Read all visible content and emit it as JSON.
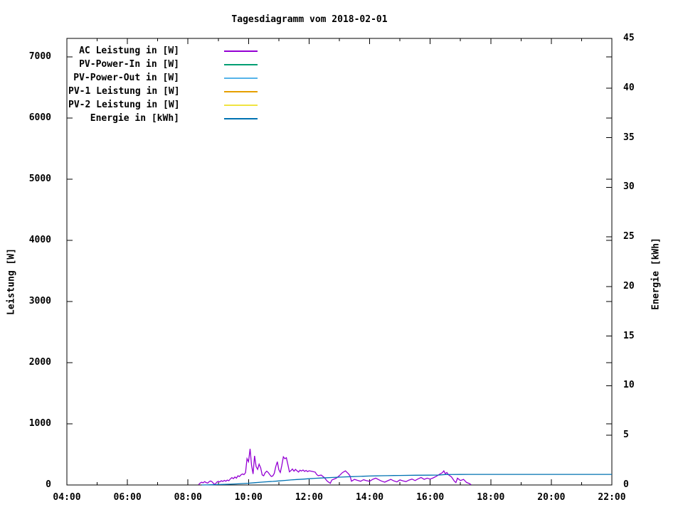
{
  "chart_data": {
    "type": "line",
    "title": "Tagesdiagramm vom 2018-02-01",
    "grid": false,
    "legend_position": "top-left-inside",
    "background_color": "#ffffff",
    "axis_color": "#000000",
    "x_axis": {
      "unit": "time",
      "min_hour": 4,
      "max_hour": 22,
      "major_hours": [
        4,
        6,
        8,
        10,
        12,
        14,
        16,
        18,
        20,
        22
      ],
      "major_labels": [
        "04:00",
        "06:00",
        "08:00",
        "10:00",
        "12:00",
        "14:00",
        "16:00",
        "18:00",
        "20:00",
        "22:00"
      ],
      "minor_hours": [
        5,
        7,
        9,
        11,
        13,
        15,
        17,
        19,
        21
      ]
    },
    "y_left": {
      "label": "Leistung [W]",
      "min": 0,
      "max": 7300,
      "ticks": [
        0,
        1000,
        2000,
        3000,
        4000,
        5000,
        6000,
        7000
      ]
    },
    "y_right": {
      "label": "Energie [kWh]",
      "min": 0,
      "max": 45,
      "ticks": [
        0,
        5,
        10,
        15,
        20,
        25,
        30,
        35,
        40,
        45
      ]
    },
    "series": [
      {
        "name": "AC Leistung in [W]",
        "color": "#9400d3",
        "yaxis": "left",
        "points": [
          [
            8.35,
            5
          ],
          [
            8.4,
            30
          ],
          [
            8.45,
            45
          ],
          [
            8.5,
            35
          ],
          [
            8.55,
            55
          ],
          [
            8.6,
            40
          ],
          [
            8.65,
            30
          ],
          [
            8.7,
            55
          ],
          [
            8.75,
            65
          ],
          [
            8.8,
            50
          ],
          [
            8.85,
            20
          ],
          [
            8.9,
            12
          ],
          [
            8.95,
            45
          ],
          [
            9.0,
            60
          ],
          [
            9.05,
            50
          ],
          [
            9.1,
            70
          ],
          [
            9.15,
            58
          ],
          [
            9.2,
            75
          ],
          [
            9.25,
            62
          ],
          [
            9.3,
            80
          ],
          [
            9.35,
            70
          ],
          [
            9.4,
            100
          ],
          [
            9.45,
            120
          ],
          [
            9.5,
            105
          ],
          [
            9.55,
            130
          ],
          [
            9.6,
            112
          ],
          [
            9.65,
            150
          ],
          [
            9.7,
            138
          ],
          [
            9.75,
            165
          ],
          [
            9.8,
            180
          ],
          [
            9.85,
            168
          ],
          [
            9.9,
            200
          ],
          [
            9.95,
            430
          ],
          [
            10.0,
            380
          ],
          [
            10.05,
            590
          ],
          [
            10.1,
            320
          ],
          [
            10.15,
            180
          ],
          [
            10.2,
            475
          ],
          [
            10.25,
            300
          ],
          [
            10.3,
            255
          ],
          [
            10.35,
            340
          ],
          [
            10.4,
            280
          ],
          [
            10.45,
            165
          ],
          [
            10.5,
            150
          ],
          [
            10.55,
            200
          ],
          [
            10.6,
            225
          ],
          [
            10.65,
            205
          ],
          [
            10.7,
            170
          ],
          [
            10.75,
            140
          ],
          [
            10.8,
            148
          ],
          [
            10.85,
            190
          ],
          [
            10.9,
            300
          ],
          [
            10.95,
            380
          ],
          [
            11.0,
            250
          ],
          [
            11.05,
            205
          ],
          [
            11.1,
            320
          ],
          [
            11.15,
            460
          ],
          [
            11.2,
            430
          ],
          [
            11.25,
            445
          ],
          [
            11.3,
            330
          ],
          [
            11.35,
            215
          ],
          [
            11.4,
            235
          ],
          [
            11.45,
            262
          ],
          [
            11.5,
            225
          ],
          [
            11.55,
            255
          ],
          [
            11.6,
            232
          ],
          [
            11.65,
            212
          ],
          [
            11.7,
            242
          ],
          [
            11.75,
            228
          ],
          [
            11.8,
            245
          ],
          [
            11.85,
            222
          ],
          [
            11.9,
            238
          ],
          [
            11.95,
            218
          ],
          [
            12.0,
            232
          ],
          [
            12.1,
            222
          ],
          [
            12.2,
            210
          ],
          [
            12.25,
            172
          ],
          [
            12.3,
            152
          ],
          [
            12.4,
            162
          ],
          [
            12.5,
            122
          ],
          [
            12.6,
            62
          ],
          [
            12.7,
            28
          ],
          [
            12.75,
            80
          ],
          [
            12.8,
            92
          ],
          [
            12.9,
            112
          ],
          [
            13.0,
            152
          ],
          [
            13.1,
            202
          ],
          [
            13.2,
            230
          ],
          [
            13.3,
            182
          ],
          [
            13.35,
            150
          ],
          [
            13.4,
            62
          ],
          [
            13.5,
            92
          ],
          [
            13.6,
            75
          ],
          [
            13.7,
            60
          ],
          [
            13.8,
            86
          ],
          [
            13.9,
            70
          ],
          [
            14.0,
            60
          ],
          [
            14.1,
            92
          ],
          [
            14.2,
            112
          ],
          [
            14.3,
            86
          ],
          [
            14.4,
            62
          ],
          [
            14.5,
            46
          ],
          [
            14.6,
            70
          ],
          [
            14.7,
            92
          ],
          [
            14.8,
            66
          ],
          [
            14.9,
            50
          ],
          [
            15.0,
            82
          ],
          [
            15.1,
            66
          ],
          [
            15.2,
            55
          ],
          [
            15.3,
            80
          ],
          [
            15.4,
            96
          ],
          [
            15.5,
            72
          ],
          [
            15.6,
            100
          ],
          [
            15.7,
            122
          ],
          [
            15.8,
            92
          ],
          [
            15.9,
            112
          ],
          [
            16.0,
            96
          ],
          [
            16.1,
            116
          ],
          [
            16.2,
            142
          ],
          [
            16.3,
            172
          ],
          [
            16.4,
            200
          ],
          [
            16.45,
            230
          ],
          [
            16.5,
            185
          ],
          [
            16.55,
            205
          ],
          [
            16.6,
            168
          ],
          [
            16.7,
            132
          ],
          [
            16.8,
            62
          ],
          [
            16.85,
            40
          ],
          [
            16.9,
            110
          ],
          [
            17.0,
            72
          ],
          [
            17.1,
            92
          ],
          [
            17.2,
            42
          ],
          [
            17.3,
            22
          ],
          [
            17.35,
            2
          ]
        ]
      },
      {
        "name": "PV-Power-In in [W]",
        "color": "#009e73",
        "yaxis": "left",
        "points": []
      },
      {
        "name": "PV-Power-Out in [W]",
        "color": "#56b4e9",
        "yaxis": "left",
        "points": []
      },
      {
        "name": "PV-1 Leistung in [W]",
        "color": "#e69f00",
        "yaxis": "left",
        "points": []
      },
      {
        "name": "PV-2 Leistung in [W]",
        "color": "#f0e442",
        "yaxis": "left",
        "points": []
      },
      {
        "name": "Energie in [kWh]",
        "color": "#0072b2",
        "yaxis": "right",
        "points": [
          [
            8.45,
            0
          ],
          [
            8.6,
            0.01
          ],
          [
            8.8,
            0.02
          ],
          [
            9.0,
            0.04
          ],
          [
            9.2,
            0.06
          ],
          [
            9.4,
            0.08
          ],
          [
            9.6,
            0.11
          ],
          [
            9.8,
            0.14
          ],
          [
            10.0,
            0.18
          ],
          [
            10.2,
            0.23
          ],
          [
            10.4,
            0.28
          ],
          [
            10.6,
            0.32
          ],
          [
            10.8,
            0.36
          ],
          [
            11.0,
            0.41
          ],
          [
            11.2,
            0.46
          ],
          [
            11.4,
            0.51
          ],
          [
            11.6,
            0.55
          ],
          [
            11.8,
            0.59
          ],
          [
            12.0,
            0.63
          ],
          [
            12.2,
            0.67
          ],
          [
            12.4,
            0.7
          ],
          [
            12.6,
            0.73
          ],
          [
            12.8,
            0.76
          ],
          [
            13.0,
            0.79
          ],
          [
            13.2,
            0.82
          ],
          [
            13.4,
            0.84
          ],
          [
            13.6,
            0.86
          ],
          [
            13.8,
            0.88
          ],
          [
            14.0,
            0.9
          ],
          [
            14.2,
            0.92
          ],
          [
            14.4,
            0.93
          ],
          [
            14.6,
            0.94
          ],
          [
            14.8,
            0.95
          ],
          [
            15.0,
            0.96
          ],
          [
            15.5,
            0.98
          ],
          [
            16.0,
            0.99
          ],
          [
            16.3,
            1.0
          ],
          [
            16.5,
            1.05
          ],
          [
            17.0,
            1.06
          ],
          [
            17.3,
            1.07
          ],
          [
            22.0,
            1.07
          ]
        ]
      }
    ]
  }
}
